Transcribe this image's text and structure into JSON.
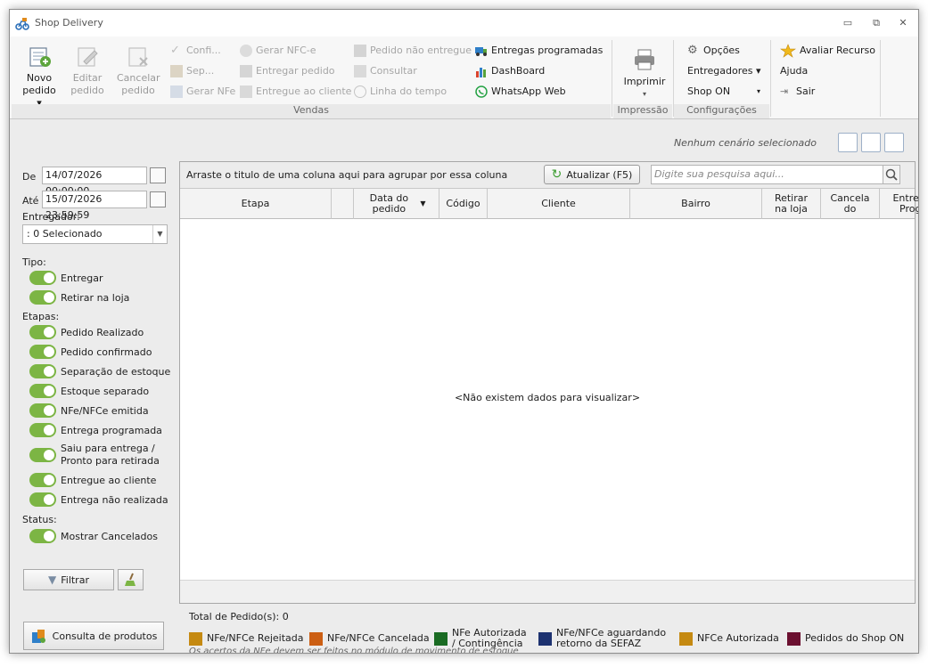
{
  "window": {
    "title": "Shop Delivery"
  },
  "ribbon": {
    "vendas": {
      "label": "Vendas",
      "novo_pedido": "Novo pedido ▾",
      "editar_pedido": "Editar pedido",
      "cancelar_pedido": "Cancelar pedido",
      "confirmar": "Confi...",
      "separar": "Sep...",
      "gerar_nfe": "Gerar NFe",
      "gerar_nfce": "Gerar NFC-e",
      "entregar_pedido": "Entregar pedido",
      "entregue_cliente": "Entregue ao cliente",
      "pedido_nao_entregue": "Pedido não entregue",
      "consultar": "Consultar",
      "linha_tempo": "Linha do tempo",
      "entregas_programadas": "Entregas programadas",
      "dashboard": "DashBoard",
      "whatsapp": "WhatsApp Web"
    },
    "impressao": {
      "label": "Impressão",
      "imprimir": "Imprimir"
    },
    "configuracoes": {
      "label": "Configurações",
      "opcoes": "Opções",
      "entregadores": "Entregadores ▾",
      "shop_on": "Shop ON"
    },
    "extras": {
      "avaliar": "Avaliar Recurso",
      "ajuda": "Ajuda",
      "sair": "Sair"
    }
  },
  "filters": {
    "de_label": "De",
    "de_value": "14/07/2026 00:00:00",
    "ate_label": "Até",
    "ate_value": "15/07/2026 23:59:59",
    "entregador_label": "Entregador:",
    "entregador_value": ": 0 Selecionado",
    "tipo_label": "Tipo:",
    "tipo": [
      "Entregar",
      "Retirar na loja"
    ],
    "etapas_label": "Etapas:",
    "etapas": [
      "Pedido Realizado",
      "Pedido confirmado",
      "Separação de estoque",
      "Estoque separado",
      "NFe/NFCe emitida",
      "Entrega programada",
      "Saiu para entrega / Pronto para retirada",
      "Entregue ao cliente",
      "Entrega não realizada"
    ],
    "status_label": "Status:",
    "status": [
      "Mostrar Cancelados"
    ],
    "filtrar": "Filtrar",
    "consulta_produtos": "Consulta de produtos"
  },
  "grid": {
    "cenario": "Nenhum cenário selecionado",
    "group_hint": "Arraste o titulo de uma coluna aqui para agrupar por essa coluna",
    "refresh": "Atualizar (F5)",
    "search_placeholder": "Digite sua pesquisa aqui...",
    "columns": [
      "Etapa",
      "Data do pedido",
      "Código",
      "Cliente",
      "Bairro",
      "Retirar na loja",
      "Cancelado",
      "Entrega Prog."
    ],
    "empty": "<Não existem dados para visualizar>"
  },
  "footer": {
    "total": "Total de Pedido(s):  0",
    "legend": [
      {
        "label": "NFe/NFCe Rejeitada",
        "color": "#c58a12"
      },
      {
        "label": "NFe/NFCe Cancelada",
        "color": "#cc5f14"
      },
      {
        "label": "NFe Autorizada / Contingência",
        "color": "#1a6b23"
      },
      {
        "label": "NFe/NFCe aguardando retorno da SEFAZ",
        "color": "#1d3270"
      },
      {
        "label": "NFCe Autorizada",
        "color": "#c58a12"
      },
      {
        "label": "Pedidos do Shop ON",
        "color": "#6b1030"
      }
    ],
    "note": "Os acertos da NFe devem ser feitos no módulo de movimento de estoque"
  }
}
